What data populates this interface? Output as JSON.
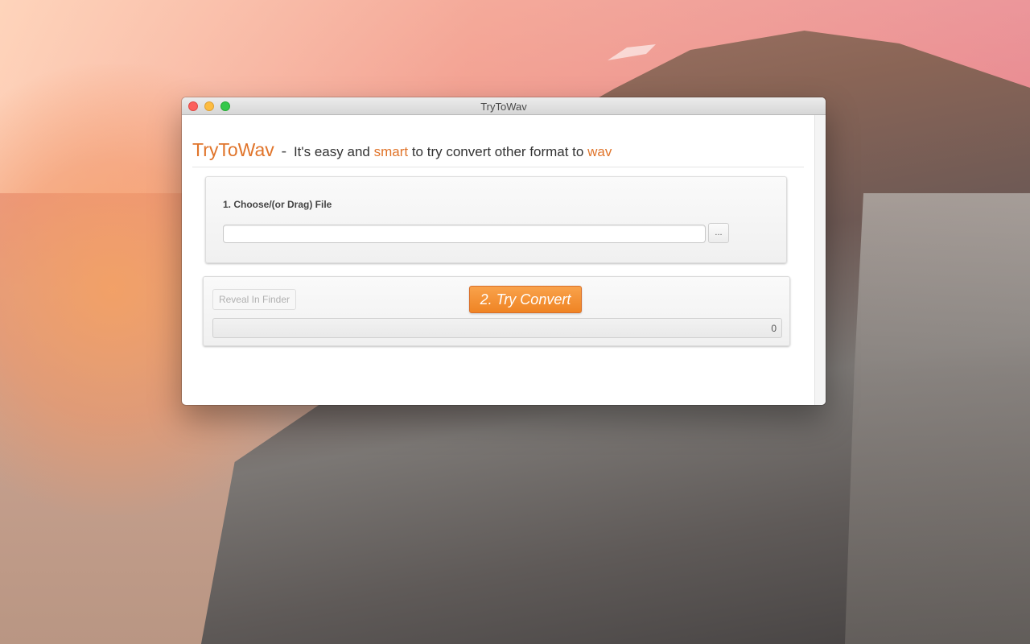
{
  "window": {
    "title": "TryToWav"
  },
  "header": {
    "brand": "TryToWav",
    "separator": "-",
    "tagline_part1": "It's easy and",
    "tagline_accent1": "smart",
    "tagline_part2": "to try convert other format to",
    "tagline_accent2": "wav"
  },
  "file_panel": {
    "step_label": "1. Choose/(or Drag) File",
    "file_path_value": "",
    "file_path_placeholder": "",
    "browse_label": "..."
  },
  "convert_panel": {
    "reveal_label": "Reveal In Finder",
    "convert_label": "2. Try Convert",
    "progress_count": "0",
    "progress_fraction": 0
  },
  "colors": {
    "accent": "#e0742a",
    "button_orange": "#f29a3d"
  },
  "icons": [
    "close-icon",
    "minimize-icon",
    "zoom-icon"
  ]
}
